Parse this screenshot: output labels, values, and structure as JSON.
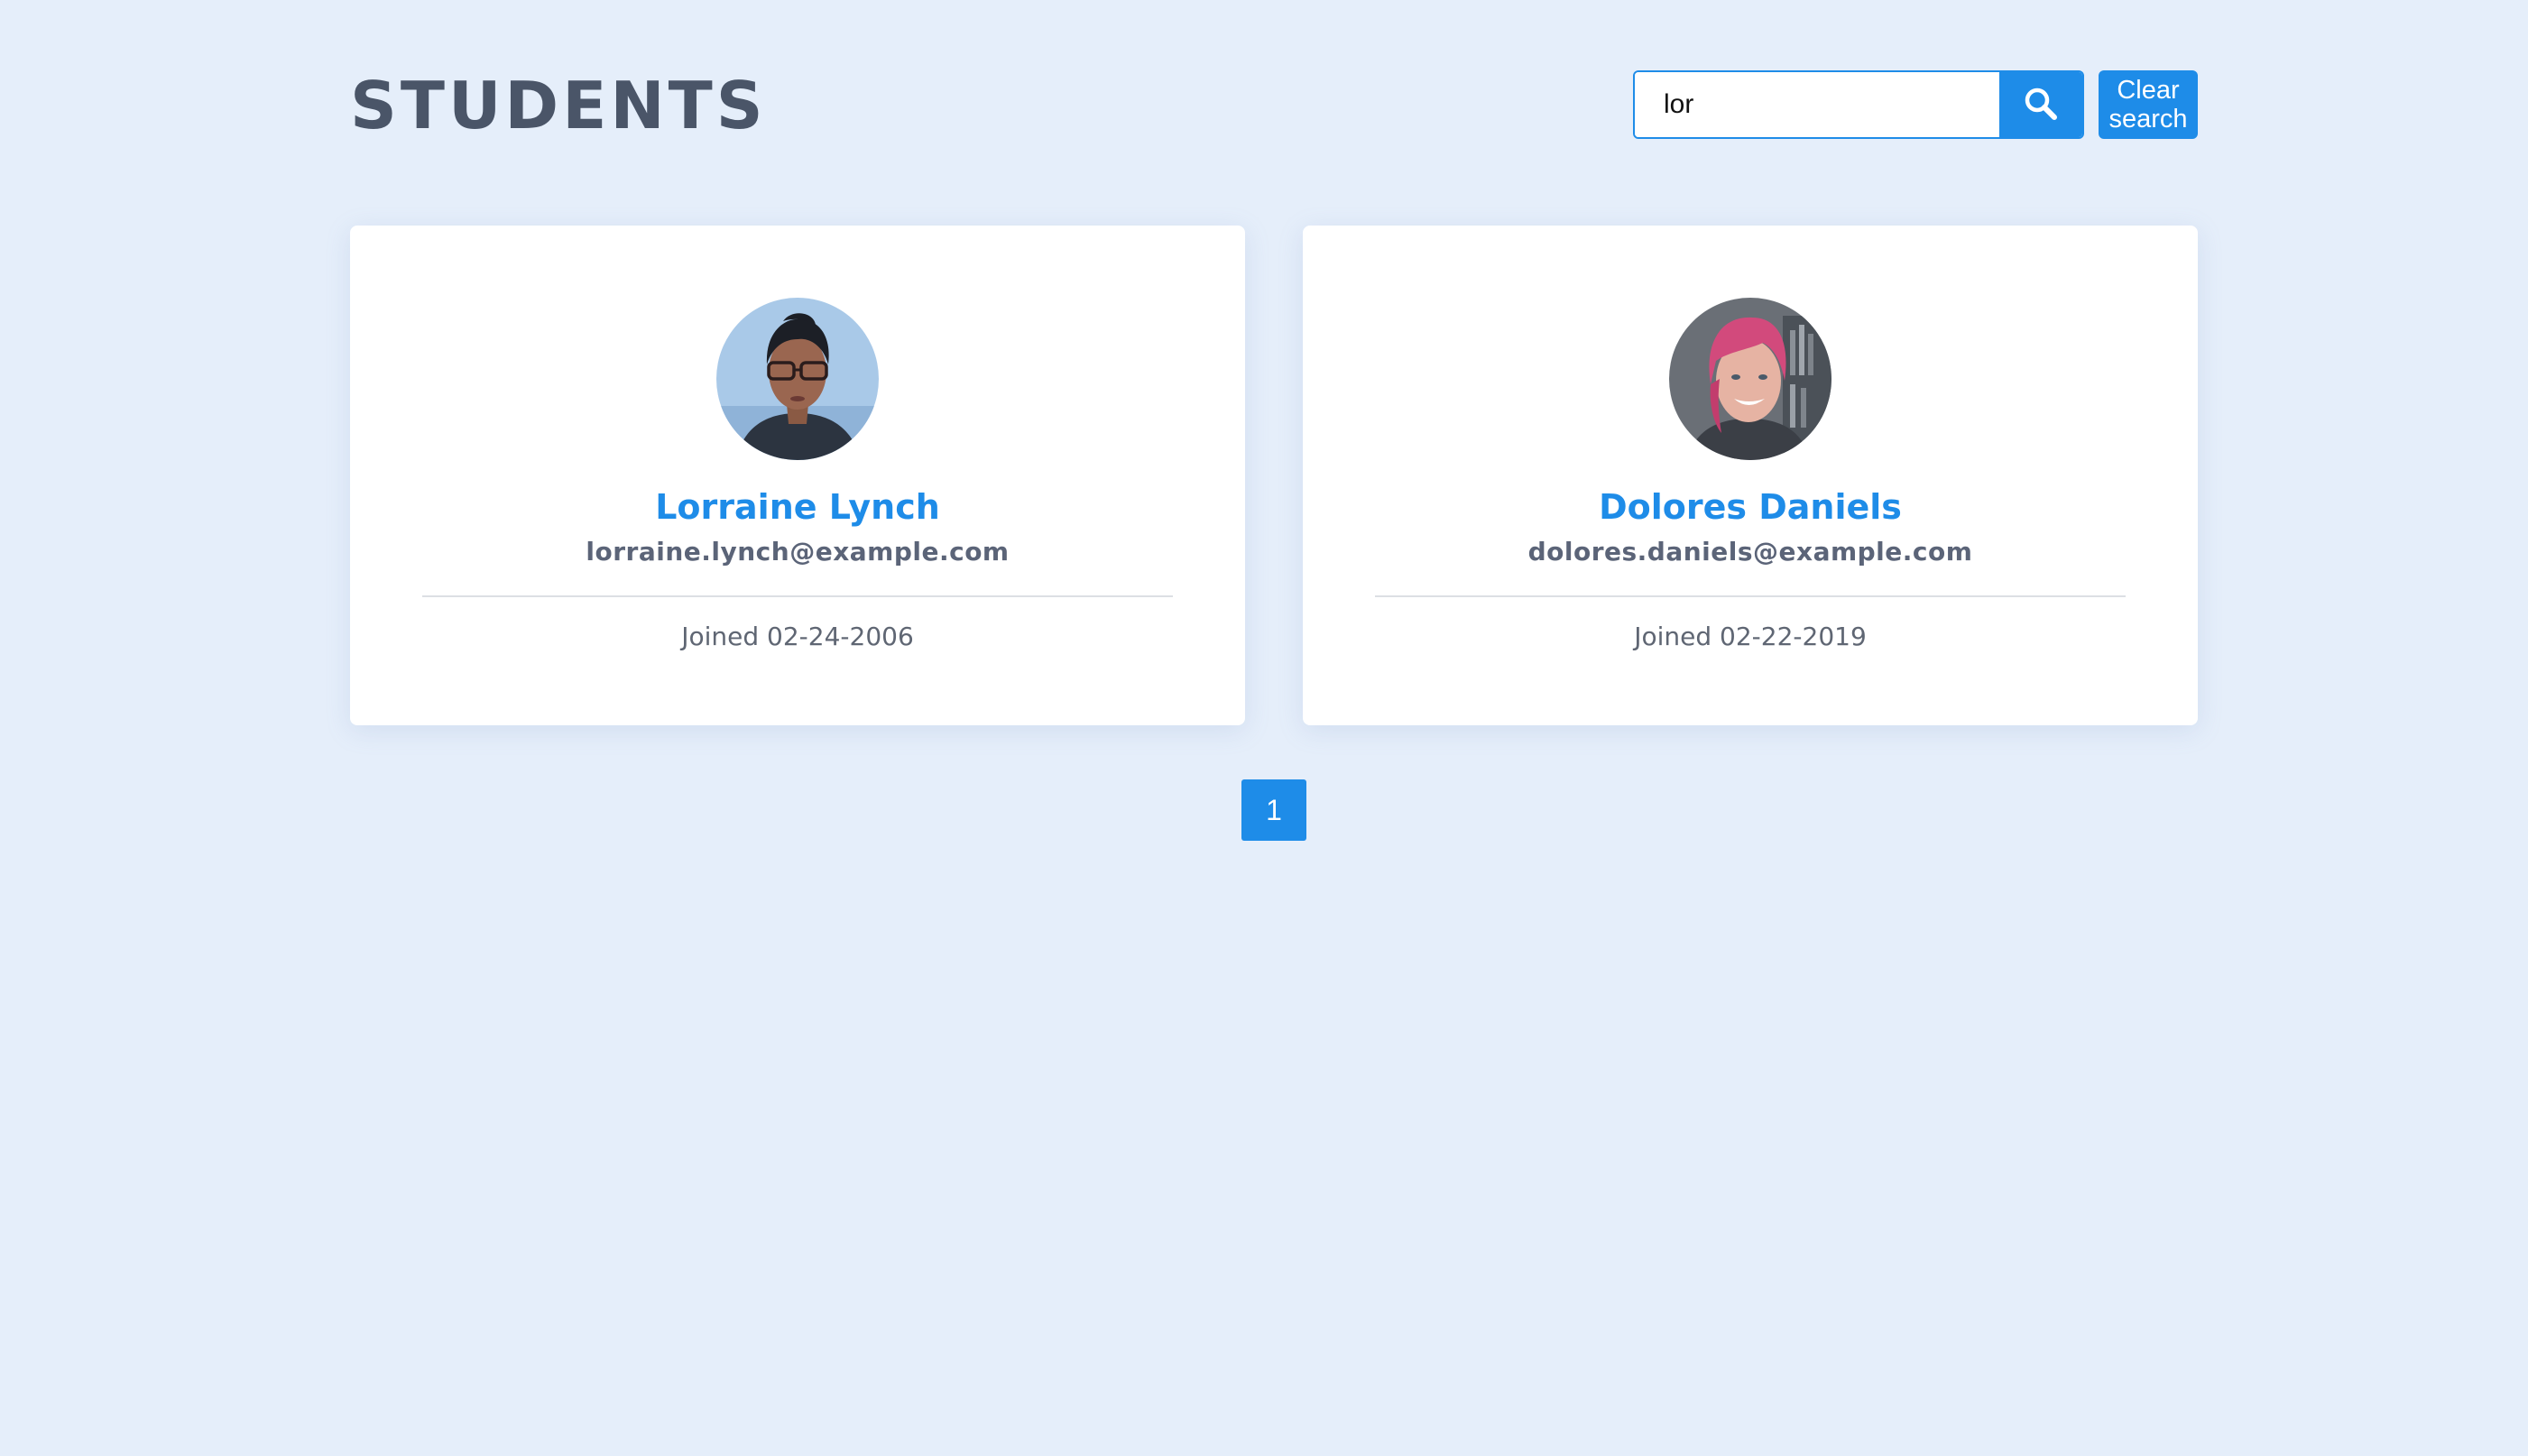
{
  "header": {
    "title": "STUDENTS"
  },
  "search": {
    "value": "lor",
    "button_icon": "search-icon",
    "clear_label": "Clear search"
  },
  "students": [
    {
      "name": "Lorraine Lynch",
      "email": "lorraine.lynch@example.com",
      "joined": "Joined 02-24-2006"
    },
    {
      "name": "Dolores Daniels",
      "email": "dolores.daniels@example.com",
      "joined": "Joined 02-22-2019"
    }
  ],
  "pagination": {
    "pages": [
      "1"
    ],
    "current": "1"
  },
  "colors": {
    "background": "#e5eefa",
    "accent": "#1e8ce8",
    "title": "#4a5568"
  }
}
